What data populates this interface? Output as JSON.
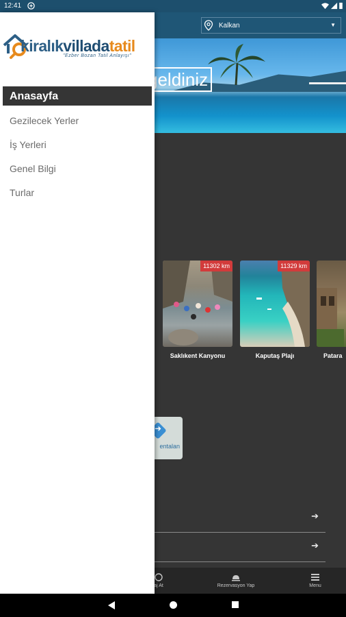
{
  "status": {
    "time": "12:41"
  },
  "topbar": {
    "location": "Kalkan"
  },
  "hero": {
    "welcome": "geldiniz"
  },
  "cards": [
    {
      "distance": "11302 km",
      "name": "Saklıkent Kanyonu"
    },
    {
      "distance": "11329 km",
      "name": "Kaputaş Plajı"
    },
    {
      "distance": "",
      "name": "Patara"
    }
  ],
  "rent_tile": {
    "label": "entalan"
  },
  "bottom_nav": [
    {
      "label": "aj At",
      "icon": "whatsapp-icon"
    },
    {
      "label": "Rezervasyon Yap",
      "icon": "reception-bell-icon"
    },
    {
      "label": "Menu",
      "icon": "hamburger-icon"
    }
  ],
  "drawer": {
    "logo": {
      "part1": "kiralık",
      "part2": "villada",
      "part3": "tatil",
      "slogan": "\"Ezber Bozan Tatil Anlayışı\""
    },
    "menu": {
      "active": "Anasayfa",
      "items": [
        "Gezilecek Yerler",
        "İş Yerleri",
        "Genel Bilgi",
        "Turlar"
      ]
    }
  },
  "colors": {
    "primary": "#1f5676",
    "accent": "#e78a1d",
    "distance_badge": "#d23b3b",
    "drawer_active": "#353535"
  }
}
